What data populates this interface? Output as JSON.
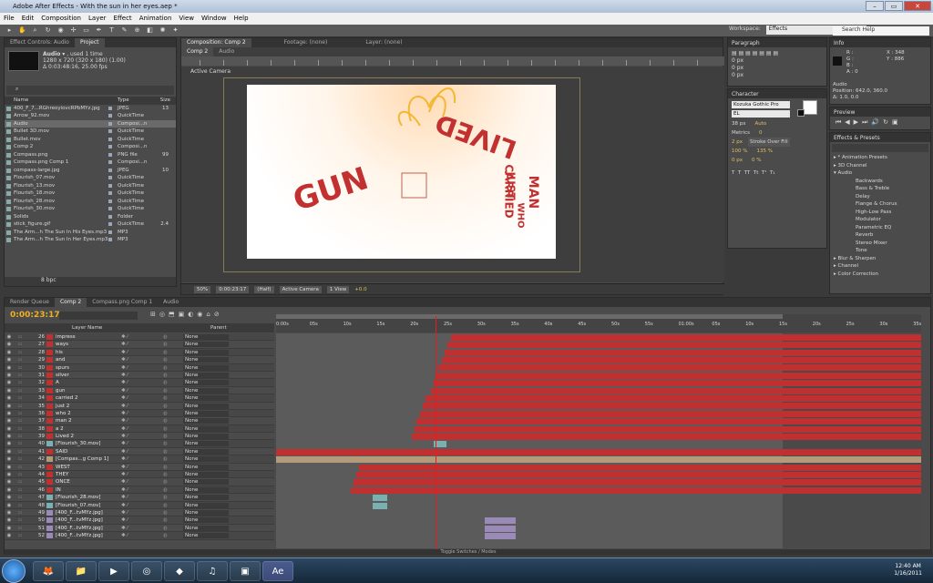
{
  "title": "Adobe After Effects - With the sun in her eyes.aep *",
  "menu": [
    "File",
    "Edit",
    "Composition",
    "Layer",
    "Effect",
    "Animation",
    "View",
    "Window",
    "Help"
  ],
  "workspace": {
    "label": "Workspace:",
    "value": "Effects"
  },
  "help_placeholder": "Search Help",
  "project": {
    "tabs": [
      "Effect Controls: Audio",
      "Project"
    ],
    "item_name": "Audio",
    "item_used": ", used 1 time",
    "item_dims": "1280 x 720  (320 x 180) (1.00)",
    "item_dur": "Δ 0:03:48:16, 25.00 fps",
    "cols": [
      "Name",
      "Type",
      "Size"
    ],
    "items": [
      {
        "n": "400_F_7...RGhreoyiovcRPbMYz.jpg",
        "t": "JPEG",
        "s": "13"
      },
      {
        "n": "Arrow_92.mov",
        "t": "QuickTime",
        "s": ""
      },
      {
        "n": "Audio",
        "t": "Composi...n",
        "s": ""
      },
      {
        "n": "Bullet 3D.mov",
        "t": "QuickTime",
        "s": ""
      },
      {
        "n": "Bullet.mov",
        "t": "QuickTime",
        "s": ""
      },
      {
        "n": "Comp 2",
        "t": "Composi...n",
        "s": ""
      },
      {
        "n": "Compass.png",
        "t": "PNG file",
        "s": "99"
      },
      {
        "n": "Compass.png Comp 1",
        "t": "Composi...n",
        "s": ""
      },
      {
        "n": "compass-large.jpg",
        "t": "JPEG",
        "s": "10"
      },
      {
        "n": "Flourish_07.mov",
        "t": "QuickTime",
        "s": ""
      },
      {
        "n": "Flourish_13.mov",
        "t": "QuickTime",
        "s": ""
      },
      {
        "n": "Flourish_18.mov",
        "t": "QuickTime",
        "s": ""
      },
      {
        "n": "Flourish_28.mov",
        "t": "QuickTime",
        "s": ""
      },
      {
        "n": "Flourish_30.mov",
        "t": "QuickTime",
        "s": ""
      },
      {
        "n": "Solids",
        "t": "Folder",
        "s": ""
      },
      {
        "n": "stick_figure.gif",
        "t": "QuickTime",
        "s": "2.4"
      },
      {
        "n": "The Arm...h The Sun In His Eyes.mp3",
        "t": "MP3",
        "s": ""
      },
      {
        "n": "The Arm...h The Sun In Her Eyes.mp3",
        "t": "MP3",
        "s": ""
      }
    ],
    "bpc": "8 bpc"
  },
  "comp": {
    "tabs": [
      "Composition: Comp 2",
      "Footage: (none)",
      "Layer: (none)"
    ],
    "subtabs": [
      "Comp 2",
      "Audio"
    ],
    "camera": "Active Camera",
    "texts": {
      "gun": "GUN",
      "lived": "LIVED",
      "carried": "CARRIED",
      "just": "JUST",
      "who": "WHO",
      "man": "MAN"
    },
    "footer": {
      "zoom": "50%",
      "time": "0:00:23:17",
      "res": "(Half)",
      "camera": "Active Camera",
      "view": "1 View",
      "exposure": "+0.0"
    }
  },
  "paragraph": {
    "title": "Paragraph",
    "px": [
      "0 px",
      "0 px",
      "0 px"
    ]
  },
  "character": {
    "title": "Character",
    "font": "Kozuka Gothic Pro",
    "style": "EL",
    "size": "38 px",
    "leading": "Auto",
    "tracking": "0",
    "kern": "Metrics",
    "stroke": "2 px",
    "stroke_mode": "Stroke Over Fill",
    "vscale": "100 %",
    "hscale": "135 %",
    "baseline": "0 px",
    "tsume": "0 %"
  },
  "info": {
    "title": "Info",
    "r": "R :",
    "g": "G :",
    "b": "B :",
    "a": "A : 0",
    "x": "X : 348",
    "y": "Y : 886",
    "name": "Audio",
    "pos": "Position: 642.0, 360.0",
    "delta": "Δ: 1.0, 0.0"
  },
  "preview": {
    "title": "Preview"
  },
  "effects": {
    "title": "Effects & Presets",
    "items": [
      {
        "l": "▸ * Animation Presets",
        "sub": false
      },
      {
        "l": "▸ 3D Channel",
        "sub": false
      },
      {
        "l": "▾ Audio",
        "sub": false
      },
      {
        "l": "Backwards",
        "sub": true
      },
      {
        "l": "Bass & Treble",
        "sub": true
      },
      {
        "l": "Delay",
        "sub": true
      },
      {
        "l": "Flange & Chorus",
        "sub": true
      },
      {
        "l": "High-Low Pass",
        "sub": true
      },
      {
        "l": "Modulator",
        "sub": true
      },
      {
        "l": "Parametric EQ",
        "sub": true
      },
      {
        "l": "Reverb",
        "sub": true
      },
      {
        "l": "Stereo Mixer",
        "sub": true
      },
      {
        "l": "Tone",
        "sub": true
      },
      {
        "l": "▸ Blur & Sharpen",
        "sub": false
      },
      {
        "l": "▸ Channel",
        "sub": false
      },
      {
        "l": "▸ Color Correction",
        "sub": false
      }
    ]
  },
  "timeline": {
    "tabs": [
      "Render Queue",
      "Comp 2",
      "Compass.png Comp 1",
      "Audio"
    ],
    "time": "0:00:23:17",
    "col_name": "Layer Name",
    "col_parent": "Parent",
    "none": "None",
    "ruler": [
      "0:00s",
      "05s",
      "10s",
      "15s",
      "20s",
      "25s",
      "30s",
      "35s",
      "40s",
      "45s",
      "50s",
      "55s",
      "01:00s",
      "05s",
      "10s",
      "15s",
      "20s",
      "25s",
      "30s",
      "35s"
    ],
    "toggle": "Toggle Switches / Modes",
    "layers": [
      {
        "num": "26",
        "name": "impress",
        "c": "#c03030",
        "start": 0.271
      },
      {
        "num": "27",
        "name": "ways",
        "c": "#c03030",
        "start": 0.265
      },
      {
        "num": "28",
        "name": "his",
        "c": "#c03030",
        "start": 0.261
      },
      {
        "num": "29",
        "name": "and",
        "c": "#c03030",
        "start": 0.257
      },
      {
        "num": "30",
        "name": "spurs",
        "c": "#c03030",
        "start": 0.252
      },
      {
        "num": "31",
        "name": "silver",
        "c": "#c03030",
        "start": 0.248
      },
      {
        "num": "32",
        "name": "A",
        "c": "#c03030",
        "start": 0.244
      },
      {
        "num": "33",
        "name": "gun",
        "c": "#c03030",
        "start": 0.24
      },
      {
        "num": "34",
        "name": "carried 2",
        "c": "#c03030",
        "start": 0.231
      },
      {
        "num": "35",
        "name": "just 2",
        "c": "#c03030",
        "start": 0.227
      },
      {
        "num": "36",
        "name": "who 2",
        "c": "#c03030",
        "start": 0.223
      },
      {
        "num": "37",
        "name": "man 2",
        "c": "#c03030",
        "start": 0.218
      },
      {
        "num": "38",
        "name": "a 2",
        "c": "#c03030",
        "start": 0.214
      },
      {
        "num": "39",
        "name": "Lived 2",
        "c": "#c03030",
        "start": 0.21
      },
      {
        "num": "40",
        "name": "[Flourish_30.mov]",
        "c": "#7ab0b0",
        "start": 0.245,
        "end": 0.264
      },
      {
        "num": "41",
        "name": "SAID",
        "c": "#c03030",
        "start": 0.0
      },
      {
        "num": "42",
        "name": "[Compas...g Comp 1]",
        "c": "#b59a7a",
        "start": 0.0
      },
      {
        "num": "43",
        "name": "WEST",
        "c": "#c03030",
        "start": 0.128
      },
      {
        "num": "44",
        "name": "THEY",
        "c": "#c03030",
        "start": 0.124
      },
      {
        "num": "45",
        "name": "ONCE",
        "c": "#c03030",
        "start": 0.12
      },
      {
        "num": "46",
        "name": "IN",
        "c": "#c03030",
        "start": 0.116
      },
      {
        "num": "47",
        "name": "[Flourish_28.mov]",
        "c": "#7ab0b0",
        "start": 0.15,
        "end": 0.172
      },
      {
        "num": "48",
        "name": "[Flourish_07.mov]",
        "c": "#7ab0b0",
        "start": 0.15,
        "end": 0.172
      },
      {
        "num": "49",
        "name": "[400_F...tvMYz.jpg]",
        "c": "#9a8ab8",
        "start": 0.0,
        "end": 0.0
      },
      {
        "num": "50",
        "name": "[400_F...tvMYz.jpg]",
        "c": "#9a8ab8",
        "start": 0.323,
        "end": 0.372
      },
      {
        "num": "51",
        "name": "[400_F...tvMYz.jpg]",
        "c": "#9a8ab8",
        "start": 0.323,
        "end": 0.372
      },
      {
        "num": "52",
        "name": "[400_F...tvMYz.jpg]",
        "c": "#9a8ab8",
        "start": 0.323,
        "end": 0.372
      }
    ]
  },
  "clock": {
    "time": "12:40 AM",
    "date": "1/16/2011"
  }
}
